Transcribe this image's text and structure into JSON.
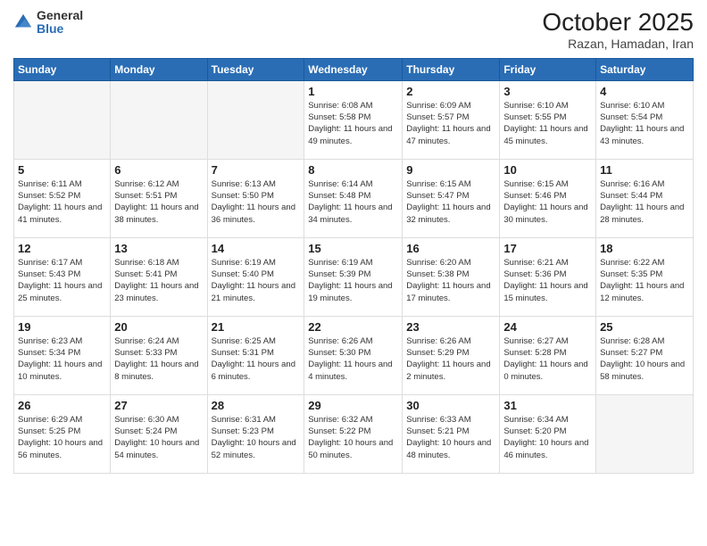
{
  "logo": {
    "general": "General",
    "blue": "Blue"
  },
  "header": {
    "month": "October 2025",
    "location": "Razan, Hamadan, Iran"
  },
  "weekdays": [
    "Sunday",
    "Monday",
    "Tuesday",
    "Wednesday",
    "Thursday",
    "Friday",
    "Saturday"
  ],
  "weeks": [
    [
      {
        "day": "",
        "sunrise": "",
        "sunset": "",
        "daylight": ""
      },
      {
        "day": "",
        "sunrise": "",
        "sunset": "",
        "daylight": ""
      },
      {
        "day": "",
        "sunrise": "",
        "sunset": "",
        "daylight": ""
      },
      {
        "day": "1",
        "sunrise": "Sunrise: 6:08 AM",
        "sunset": "Sunset: 5:58 PM",
        "daylight": "Daylight: 11 hours and 49 minutes."
      },
      {
        "day": "2",
        "sunrise": "Sunrise: 6:09 AM",
        "sunset": "Sunset: 5:57 PM",
        "daylight": "Daylight: 11 hours and 47 minutes."
      },
      {
        "day": "3",
        "sunrise": "Sunrise: 6:10 AM",
        "sunset": "Sunset: 5:55 PM",
        "daylight": "Daylight: 11 hours and 45 minutes."
      },
      {
        "day": "4",
        "sunrise": "Sunrise: 6:10 AM",
        "sunset": "Sunset: 5:54 PM",
        "daylight": "Daylight: 11 hours and 43 minutes."
      }
    ],
    [
      {
        "day": "5",
        "sunrise": "Sunrise: 6:11 AM",
        "sunset": "Sunset: 5:52 PM",
        "daylight": "Daylight: 11 hours and 41 minutes."
      },
      {
        "day": "6",
        "sunrise": "Sunrise: 6:12 AM",
        "sunset": "Sunset: 5:51 PM",
        "daylight": "Daylight: 11 hours and 38 minutes."
      },
      {
        "day": "7",
        "sunrise": "Sunrise: 6:13 AM",
        "sunset": "Sunset: 5:50 PM",
        "daylight": "Daylight: 11 hours and 36 minutes."
      },
      {
        "day": "8",
        "sunrise": "Sunrise: 6:14 AM",
        "sunset": "Sunset: 5:48 PM",
        "daylight": "Daylight: 11 hours and 34 minutes."
      },
      {
        "day": "9",
        "sunrise": "Sunrise: 6:15 AM",
        "sunset": "Sunset: 5:47 PM",
        "daylight": "Daylight: 11 hours and 32 minutes."
      },
      {
        "day": "10",
        "sunrise": "Sunrise: 6:15 AM",
        "sunset": "Sunset: 5:46 PM",
        "daylight": "Daylight: 11 hours and 30 minutes."
      },
      {
        "day": "11",
        "sunrise": "Sunrise: 6:16 AM",
        "sunset": "Sunset: 5:44 PM",
        "daylight": "Daylight: 11 hours and 28 minutes."
      }
    ],
    [
      {
        "day": "12",
        "sunrise": "Sunrise: 6:17 AM",
        "sunset": "Sunset: 5:43 PM",
        "daylight": "Daylight: 11 hours and 25 minutes."
      },
      {
        "day": "13",
        "sunrise": "Sunrise: 6:18 AM",
        "sunset": "Sunset: 5:41 PM",
        "daylight": "Daylight: 11 hours and 23 minutes."
      },
      {
        "day": "14",
        "sunrise": "Sunrise: 6:19 AM",
        "sunset": "Sunset: 5:40 PM",
        "daylight": "Daylight: 11 hours and 21 minutes."
      },
      {
        "day": "15",
        "sunrise": "Sunrise: 6:19 AM",
        "sunset": "Sunset: 5:39 PM",
        "daylight": "Daylight: 11 hours and 19 minutes."
      },
      {
        "day": "16",
        "sunrise": "Sunrise: 6:20 AM",
        "sunset": "Sunset: 5:38 PM",
        "daylight": "Daylight: 11 hours and 17 minutes."
      },
      {
        "day": "17",
        "sunrise": "Sunrise: 6:21 AM",
        "sunset": "Sunset: 5:36 PM",
        "daylight": "Daylight: 11 hours and 15 minutes."
      },
      {
        "day": "18",
        "sunrise": "Sunrise: 6:22 AM",
        "sunset": "Sunset: 5:35 PM",
        "daylight": "Daylight: 11 hours and 12 minutes."
      }
    ],
    [
      {
        "day": "19",
        "sunrise": "Sunrise: 6:23 AM",
        "sunset": "Sunset: 5:34 PM",
        "daylight": "Daylight: 11 hours and 10 minutes."
      },
      {
        "day": "20",
        "sunrise": "Sunrise: 6:24 AM",
        "sunset": "Sunset: 5:33 PM",
        "daylight": "Daylight: 11 hours and 8 minutes."
      },
      {
        "day": "21",
        "sunrise": "Sunrise: 6:25 AM",
        "sunset": "Sunset: 5:31 PM",
        "daylight": "Daylight: 11 hours and 6 minutes."
      },
      {
        "day": "22",
        "sunrise": "Sunrise: 6:26 AM",
        "sunset": "Sunset: 5:30 PM",
        "daylight": "Daylight: 11 hours and 4 minutes."
      },
      {
        "day": "23",
        "sunrise": "Sunrise: 6:26 AM",
        "sunset": "Sunset: 5:29 PM",
        "daylight": "Daylight: 11 hours and 2 minutes."
      },
      {
        "day": "24",
        "sunrise": "Sunrise: 6:27 AM",
        "sunset": "Sunset: 5:28 PM",
        "daylight": "Daylight: 11 hours and 0 minutes."
      },
      {
        "day": "25",
        "sunrise": "Sunrise: 6:28 AM",
        "sunset": "Sunset: 5:27 PM",
        "daylight": "Daylight: 10 hours and 58 minutes."
      }
    ],
    [
      {
        "day": "26",
        "sunrise": "Sunrise: 6:29 AM",
        "sunset": "Sunset: 5:25 PM",
        "daylight": "Daylight: 10 hours and 56 minutes."
      },
      {
        "day": "27",
        "sunrise": "Sunrise: 6:30 AM",
        "sunset": "Sunset: 5:24 PM",
        "daylight": "Daylight: 10 hours and 54 minutes."
      },
      {
        "day": "28",
        "sunrise": "Sunrise: 6:31 AM",
        "sunset": "Sunset: 5:23 PM",
        "daylight": "Daylight: 10 hours and 52 minutes."
      },
      {
        "day": "29",
        "sunrise": "Sunrise: 6:32 AM",
        "sunset": "Sunset: 5:22 PM",
        "daylight": "Daylight: 10 hours and 50 minutes."
      },
      {
        "day": "30",
        "sunrise": "Sunrise: 6:33 AM",
        "sunset": "Sunset: 5:21 PM",
        "daylight": "Daylight: 10 hours and 48 minutes."
      },
      {
        "day": "31",
        "sunrise": "Sunrise: 6:34 AM",
        "sunset": "Sunset: 5:20 PM",
        "daylight": "Daylight: 10 hours and 46 minutes."
      },
      {
        "day": "",
        "sunrise": "",
        "sunset": "",
        "daylight": ""
      }
    ]
  ]
}
